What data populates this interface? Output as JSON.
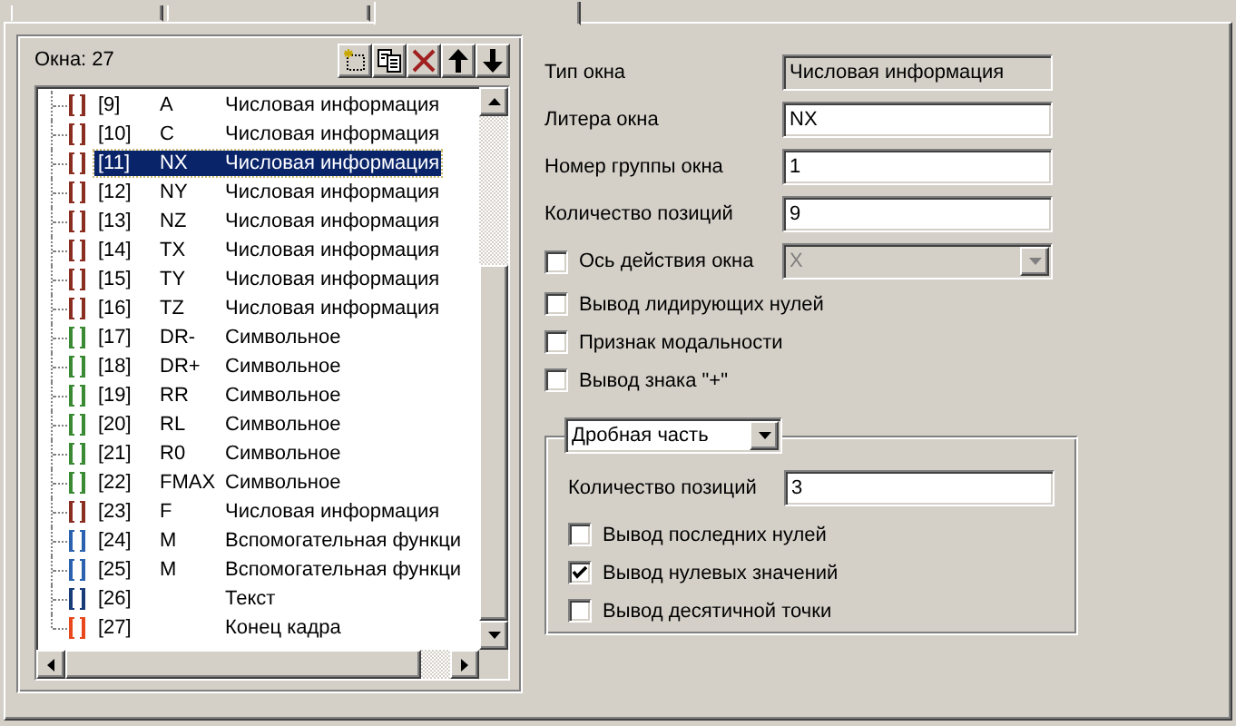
{
  "tabs": [
    {
      "selected": false
    },
    {
      "selected": false
    },
    {
      "selected": true
    }
  ],
  "windows_panel": {
    "count_label": "Окна: 27",
    "items": [
      {
        "index": "[9]",
        "letter": "A",
        "type": "Числовая информация",
        "color": "#8b2e22",
        "selected": false
      },
      {
        "index": "[10]",
        "letter": "C",
        "type": "Числовая информация",
        "color": "#8b2e22",
        "selected": false
      },
      {
        "index": "[11]",
        "letter": "NX",
        "type": "Числовая информация",
        "color": "#8b2e22",
        "selected": true
      },
      {
        "index": "[12]",
        "letter": "NY",
        "type": "Числовая информация",
        "color": "#8b2e22",
        "selected": false
      },
      {
        "index": "[13]",
        "letter": "NZ",
        "type": "Числовая информация",
        "color": "#8b2e22",
        "selected": false
      },
      {
        "index": "[14]",
        "letter": "TX",
        "type": "Числовая информация",
        "color": "#8b2e22",
        "selected": false
      },
      {
        "index": "[15]",
        "letter": "TY",
        "type": "Числовая информация",
        "color": "#8b2e22",
        "selected": false
      },
      {
        "index": "[16]",
        "letter": "TZ",
        "type": "Числовая информация",
        "color": "#8b2e22",
        "selected": false
      },
      {
        "index": "[17]",
        "letter": "DR-",
        "type": "Символьное",
        "color": "#3a8a34",
        "selected": false
      },
      {
        "index": "[18]",
        "letter": "DR+",
        "type": "Символьное",
        "color": "#3a8a34",
        "selected": false
      },
      {
        "index": "[19]",
        "letter": "RR",
        "type": "Символьное",
        "color": "#3a8a34",
        "selected": false
      },
      {
        "index": "[20]",
        "letter": "RL",
        "type": "Символьное",
        "color": "#3a8a34",
        "selected": false
      },
      {
        "index": "[21]",
        "letter": "R0",
        "type": "Символьное",
        "color": "#3a8a34",
        "selected": false
      },
      {
        "index": "[22]",
        "letter": "FMAX",
        "type": "Символьное",
        "color": "#3a8a34",
        "selected": false
      },
      {
        "index": "[23]",
        "letter": "F",
        "type": "Числовая информация",
        "color": "#8b2e22",
        "selected": false
      },
      {
        "index": "[24]",
        "letter": "M",
        "type": "Вспомогательная функци",
        "color": "#2a62b0",
        "selected": false
      },
      {
        "index": "[25]",
        "letter": "M",
        "type": "Вспомогательная функци",
        "color": "#2a62b0",
        "selected": false
      },
      {
        "index": "[26]",
        "type": "Текст",
        "color": "#173c78",
        "selected": false
      },
      {
        "index": "[27]",
        "type": "Конец кадра",
        "color": "#e8481c",
        "selected": false
      }
    ]
  },
  "properties": {
    "fields": [
      {
        "kind": "readonly",
        "label": "Тип окна",
        "value": "Числовая информация"
      },
      {
        "kind": "input",
        "label": "Литера окна",
        "value": "NX"
      },
      {
        "kind": "input",
        "label": "Номер группы окна",
        "value": "1"
      },
      {
        "kind": "input",
        "label": "Количество позиций",
        "value": "9"
      }
    ],
    "axis": {
      "label": "Ось действия окна",
      "checked": false,
      "value": "X",
      "disabled": true
    },
    "checkboxes": [
      {
        "label": "Вывод лидирующих нулей",
        "checked": false
      },
      {
        "label": "Признак модальности",
        "checked": false
      },
      {
        "label": "Вывод знака \"+\"",
        "checked": false
      }
    ],
    "fraction": {
      "selector": "Дробная часть",
      "field": {
        "label": "Количество позиций",
        "value": "3"
      },
      "checkboxes": [
        {
          "label": "Вывод последних нулей",
          "checked": false
        },
        {
          "label": "Вывод нулевых значений",
          "checked": true
        },
        {
          "label": "Вывод десятичной точки",
          "checked": false
        }
      ]
    }
  }
}
